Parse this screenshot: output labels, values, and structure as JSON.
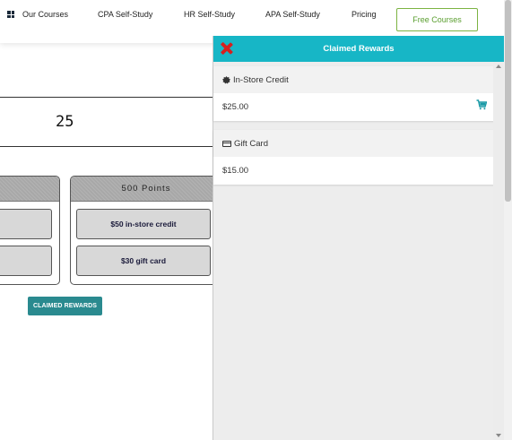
{
  "nav": {
    "items": [
      {
        "label": "Our Courses",
        "icon": "grid-icon"
      },
      {
        "label": "CPA Self-Study"
      },
      {
        "label": "HR Self-Study"
      },
      {
        "label": "APA Self-Study"
      },
      {
        "label": "Pricing"
      }
    ],
    "cta": "Free Courses"
  },
  "main": {
    "points": "25",
    "tiers": [
      {
        "heading": "",
        "rewards": [
          "",
          ""
        ]
      },
      {
        "heading": "500 Points",
        "rewards": [
          "$50 in-store credit",
          "$30 gift card"
        ]
      }
    ],
    "claimed_button": "CLAIMED REWARDS"
  },
  "panel": {
    "title": "Claimed Rewards",
    "close_icon": "close-icon",
    "cards": [
      {
        "title": "In-Store Credit",
        "icon": "badge-icon",
        "value": "$25.00",
        "action_icon": "cart-icon"
      },
      {
        "title": "Gift Card",
        "icon": "credit-card-icon",
        "value": "$15.00"
      }
    ]
  },
  "colors": {
    "accent": "#17b6c6",
    "button": "#2a8a8f",
    "cta_border": "#7cb342",
    "close": "#d61f1f"
  }
}
